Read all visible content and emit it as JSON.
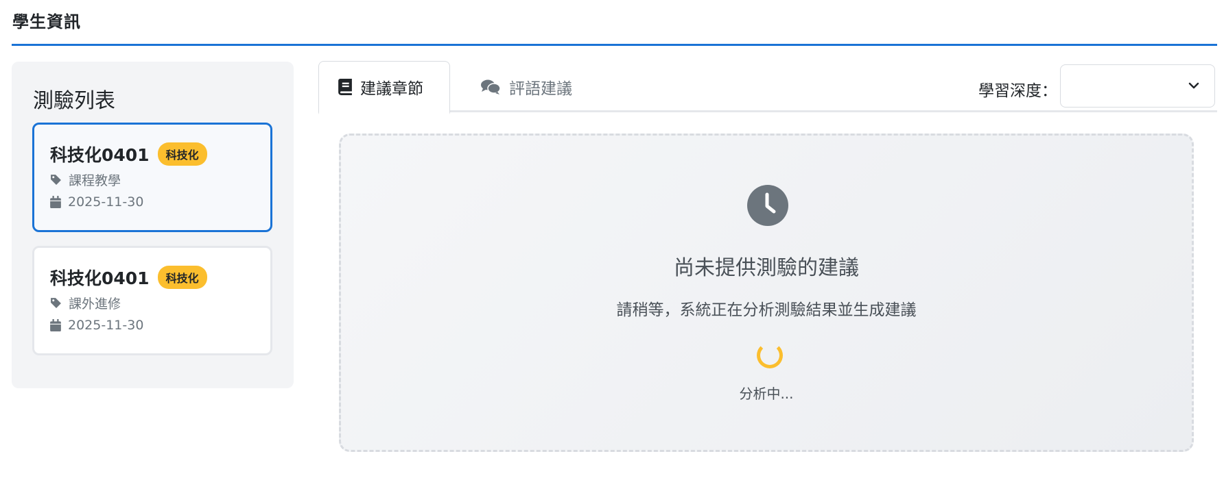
{
  "header": {
    "title": "學生資訊"
  },
  "sidebar": {
    "title": "測驗列表",
    "cards": [
      {
        "title": "科技化0401",
        "badge": "科技化",
        "category": "課程教學",
        "date": "2025-11-30",
        "active": true
      },
      {
        "title": "科技化0401",
        "badge": "科技化",
        "category": "課外進修",
        "date": "2025-11-30",
        "active": false
      }
    ]
  },
  "tabs": [
    {
      "label": "建議章節",
      "icon": "book-icon",
      "active": true
    },
    {
      "label": "評語建議",
      "icon": "comments-icon",
      "active": false
    }
  ],
  "depth": {
    "label": "學習深度：",
    "value": ""
  },
  "panel": {
    "icon": "clock-icon",
    "title": "尚未提供測驗的建議",
    "subtitle": "請稍等，系統正在分析測驗結果並生成建議",
    "loading_text": "分析中..."
  },
  "colors": {
    "accent": "#1a73d6",
    "badge": "#fbbe2e",
    "muted": "#6c757d"
  }
}
